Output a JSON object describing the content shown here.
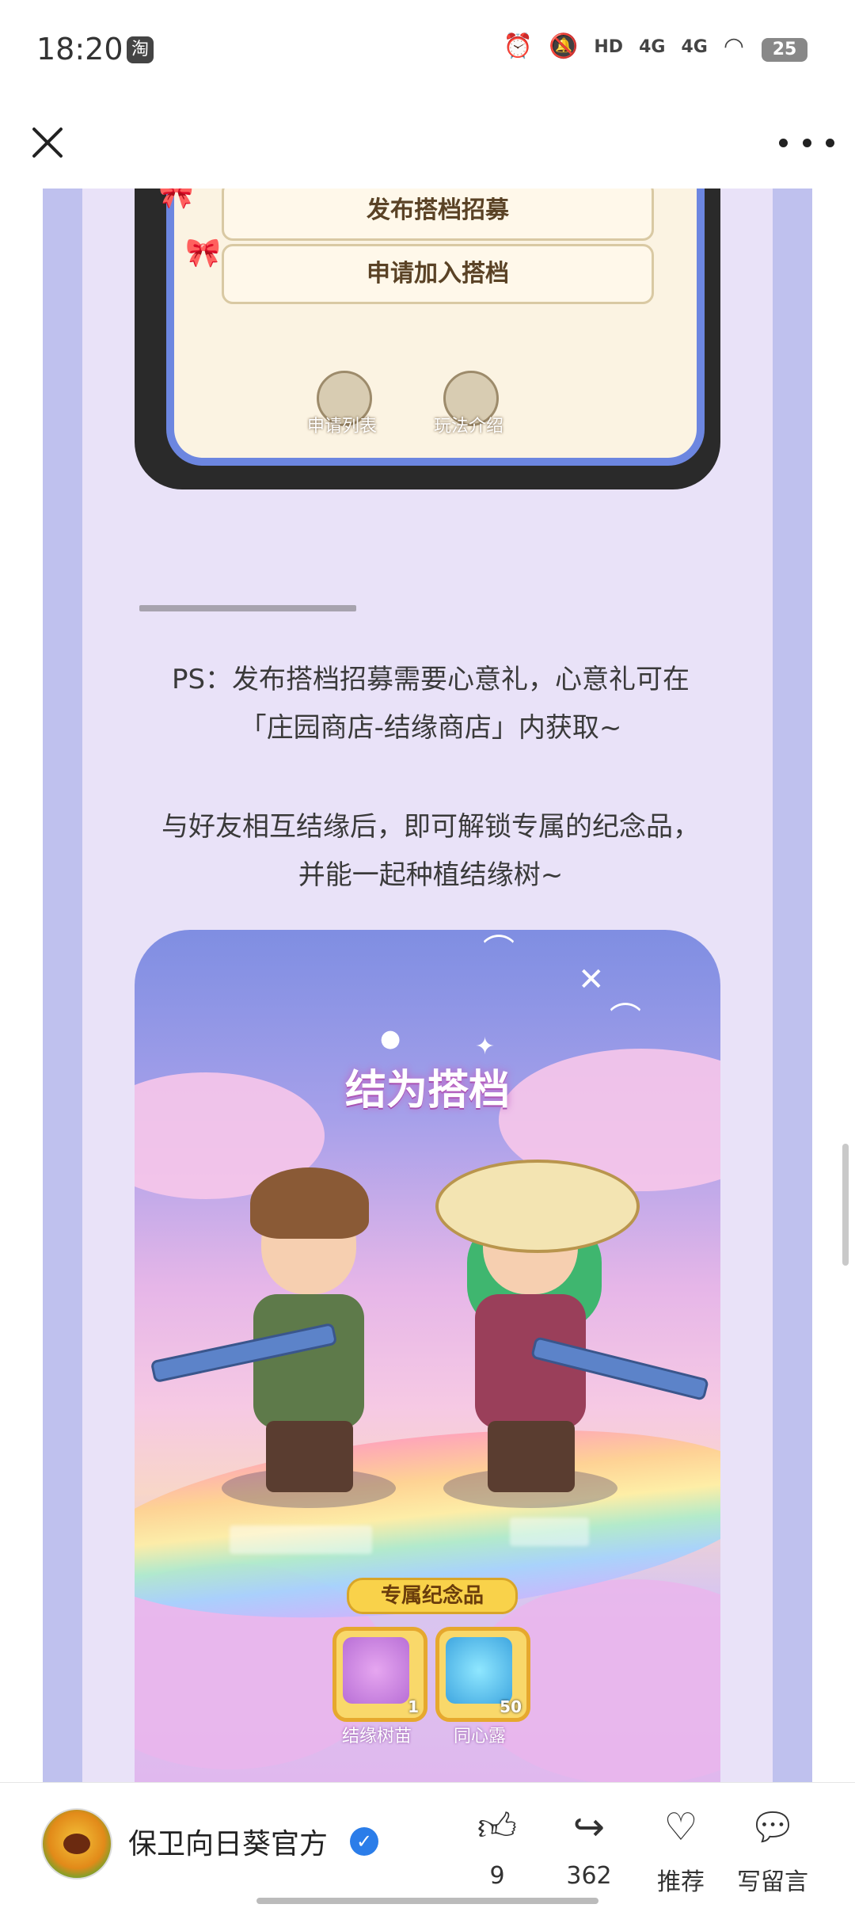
{
  "status_bar": {
    "time": "18:20",
    "app_badge": "淘",
    "signal_1": "4G",
    "signal_2": "4G",
    "battery": "25"
  },
  "header": {
    "close_icon": "close-icon",
    "more_icon": "more-icon"
  },
  "top_image": {
    "btn_publish": "发布搭档招募",
    "btn_apply": "申请加入搭档",
    "icon_list_label": "申请列表",
    "icon_guide_label": "玩法介绍"
  },
  "article": {
    "paragraph_1": "PS：发布搭档招募需要心意礼，心意礼可在「庄园商店-结缘商店」内获取~",
    "paragraph_2": "与好友相互结缘后，即可解锁专属的纪念品，并能一起种植结缘树~"
  },
  "bottom_image": {
    "title": "结为搭档",
    "souvenir_title": "专属纪念品",
    "items": [
      {
        "label": "结缘树苗",
        "count": "1"
      },
      {
        "label": "同心露",
        "count": "50"
      }
    ]
  },
  "bottom_bar": {
    "account_name": "保卫向日葵官方",
    "actions": [
      {
        "icon": "thumbs-up-icon",
        "label": "9"
      },
      {
        "icon": "share-icon",
        "label": "362"
      },
      {
        "icon": "heart-icon",
        "label": "推荐"
      },
      {
        "icon": "comment-icon",
        "label": "写留言"
      }
    ]
  }
}
